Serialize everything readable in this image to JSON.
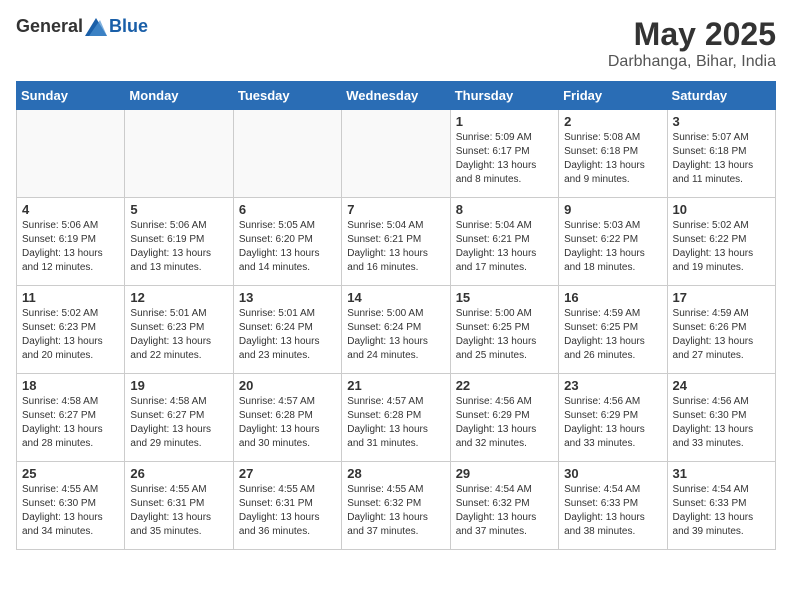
{
  "header": {
    "logo_general": "General",
    "logo_blue": "Blue",
    "month_year": "May 2025",
    "location": "Darbhanga, Bihar, India"
  },
  "days_of_week": [
    "Sunday",
    "Monday",
    "Tuesday",
    "Wednesday",
    "Thursday",
    "Friday",
    "Saturday"
  ],
  "weeks": [
    [
      {
        "day": "",
        "info": ""
      },
      {
        "day": "",
        "info": ""
      },
      {
        "day": "",
        "info": ""
      },
      {
        "day": "",
        "info": ""
      },
      {
        "day": "1",
        "info": "Sunrise: 5:09 AM\nSunset: 6:17 PM\nDaylight: 13 hours\nand 8 minutes."
      },
      {
        "day": "2",
        "info": "Sunrise: 5:08 AM\nSunset: 6:18 PM\nDaylight: 13 hours\nand 9 minutes."
      },
      {
        "day": "3",
        "info": "Sunrise: 5:07 AM\nSunset: 6:18 PM\nDaylight: 13 hours\nand 11 minutes."
      }
    ],
    [
      {
        "day": "4",
        "info": "Sunrise: 5:06 AM\nSunset: 6:19 PM\nDaylight: 13 hours\nand 12 minutes."
      },
      {
        "day": "5",
        "info": "Sunrise: 5:06 AM\nSunset: 6:19 PM\nDaylight: 13 hours\nand 13 minutes."
      },
      {
        "day": "6",
        "info": "Sunrise: 5:05 AM\nSunset: 6:20 PM\nDaylight: 13 hours\nand 14 minutes."
      },
      {
        "day": "7",
        "info": "Sunrise: 5:04 AM\nSunset: 6:21 PM\nDaylight: 13 hours\nand 16 minutes."
      },
      {
        "day": "8",
        "info": "Sunrise: 5:04 AM\nSunset: 6:21 PM\nDaylight: 13 hours\nand 17 minutes."
      },
      {
        "day": "9",
        "info": "Sunrise: 5:03 AM\nSunset: 6:22 PM\nDaylight: 13 hours\nand 18 minutes."
      },
      {
        "day": "10",
        "info": "Sunrise: 5:02 AM\nSunset: 6:22 PM\nDaylight: 13 hours\nand 19 minutes."
      }
    ],
    [
      {
        "day": "11",
        "info": "Sunrise: 5:02 AM\nSunset: 6:23 PM\nDaylight: 13 hours\nand 20 minutes."
      },
      {
        "day": "12",
        "info": "Sunrise: 5:01 AM\nSunset: 6:23 PM\nDaylight: 13 hours\nand 22 minutes."
      },
      {
        "day": "13",
        "info": "Sunrise: 5:01 AM\nSunset: 6:24 PM\nDaylight: 13 hours\nand 23 minutes."
      },
      {
        "day": "14",
        "info": "Sunrise: 5:00 AM\nSunset: 6:24 PM\nDaylight: 13 hours\nand 24 minutes."
      },
      {
        "day": "15",
        "info": "Sunrise: 5:00 AM\nSunset: 6:25 PM\nDaylight: 13 hours\nand 25 minutes."
      },
      {
        "day": "16",
        "info": "Sunrise: 4:59 AM\nSunset: 6:25 PM\nDaylight: 13 hours\nand 26 minutes."
      },
      {
        "day": "17",
        "info": "Sunrise: 4:59 AM\nSunset: 6:26 PM\nDaylight: 13 hours\nand 27 minutes."
      }
    ],
    [
      {
        "day": "18",
        "info": "Sunrise: 4:58 AM\nSunset: 6:27 PM\nDaylight: 13 hours\nand 28 minutes."
      },
      {
        "day": "19",
        "info": "Sunrise: 4:58 AM\nSunset: 6:27 PM\nDaylight: 13 hours\nand 29 minutes."
      },
      {
        "day": "20",
        "info": "Sunrise: 4:57 AM\nSunset: 6:28 PM\nDaylight: 13 hours\nand 30 minutes."
      },
      {
        "day": "21",
        "info": "Sunrise: 4:57 AM\nSunset: 6:28 PM\nDaylight: 13 hours\nand 31 minutes."
      },
      {
        "day": "22",
        "info": "Sunrise: 4:56 AM\nSunset: 6:29 PM\nDaylight: 13 hours\nand 32 minutes."
      },
      {
        "day": "23",
        "info": "Sunrise: 4:56 AM\nSunset: 6:29 PM\nDaylight: 13 hours\nand 33 minutes."
      },
      {
        "day": "24",
        "info": "Sunrise: 4:56 AM\nSunset: 6:30 PM\nDaylight: 13 hours\nand 33 minutes."
      }
    ],
    [
      {
        "day": "25",
        "info": "Sunrise: 4:55 AM\nSunset: 6:30 PM\nDaylight: 13 hours\nand 34 minutes."
      },
      {
        "day": "26",
        "info": "Sunrise: 4:55 AM\nSunset: 6:31 PM\nDaylight: 13 hours\nand 35 minutes."
      },
      {
        "day": "27",
        "info": "Sunrise: 4:55 AM\nSunset: 6:31 PM\nDaylight: 13 hours\nand 36 minutes."
      },
      {
        "day": "28",
        "info": "Sunrise: 4:55 AM\nSunset: 6:32 PM\nDaylight: 13 hours\nand 37 minutes."
      },
      {
        "day": "29",
        "info": "Sunrise: 4:54 AM\nSunset: 6:32 PM\nDaylight: 13 hours\nand 37 minutes."
      },
      {
        "day": "30",
        "info": "Sunrise: 4:54 AM\nSunset: 6:33 PM\nDaylight: 13 hours\nand 38 minutes."
      },
      {
        "day": "31",
        "info": "Sunrise: 4:54 AM\nSunset: 6:33 PM\nDaylight: 13 hours\nand 39 minutes."
      }
    ]
  ]
}
